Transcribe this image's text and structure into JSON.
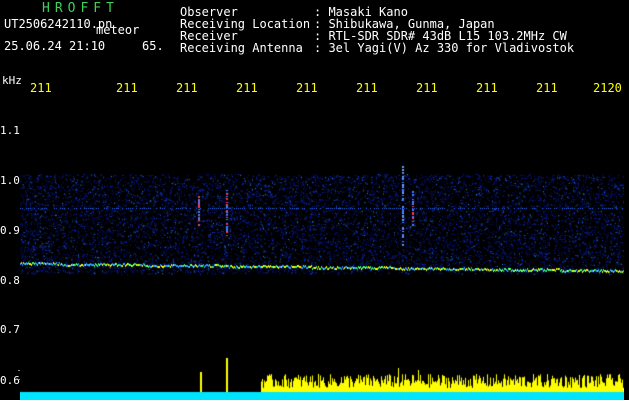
{
  "header": {
    "app_name": "HROFFT",
    "file_name": "UT2506242110.pn",
    "file_suffix": "meteor",
    "datetime": "25.06.24 21:10",
    "count": "65."
  },
  "info": [
    {
      "key": "Observer",
      "value": ": Masaki Kano"
    },
    {
      "key": "Receiving Location",
      "value": ": Shibukawa, Gunma, Japan"
    },
    {
      "key": "Receiver",
      "value": ": RTL-SDR SDR# 43dB L15 103.2MHz CW"
    },
    {
      "key": "Receiving Antenna",
      "value": ": 3el Yagi(V) Az 330 for Vladivostok"
    }
  ],
  "axis": {
    "unit": "kHz",
    "x_ticks": [
      "211",
      "211",
      "211",
      "211",
      "211",
      "211",
      "211",
      "211",
      "211",
      "2120"
    ],
    "y_ticks": [
      "1.1",
      "1.0",
      "0.9",
      "0.8",
      "0.7",
      "0.6"
    ]
  },
  "colors": {
    "background": "#000000",
    "label_green": "#3fd05a",
    "tick_yellow": "#ffff00",
    "signal_yellow": "#ffff00",
    "noise_cyan": "#00e5ff",
    "noise_blue": "#1a3cff"
  }
}
